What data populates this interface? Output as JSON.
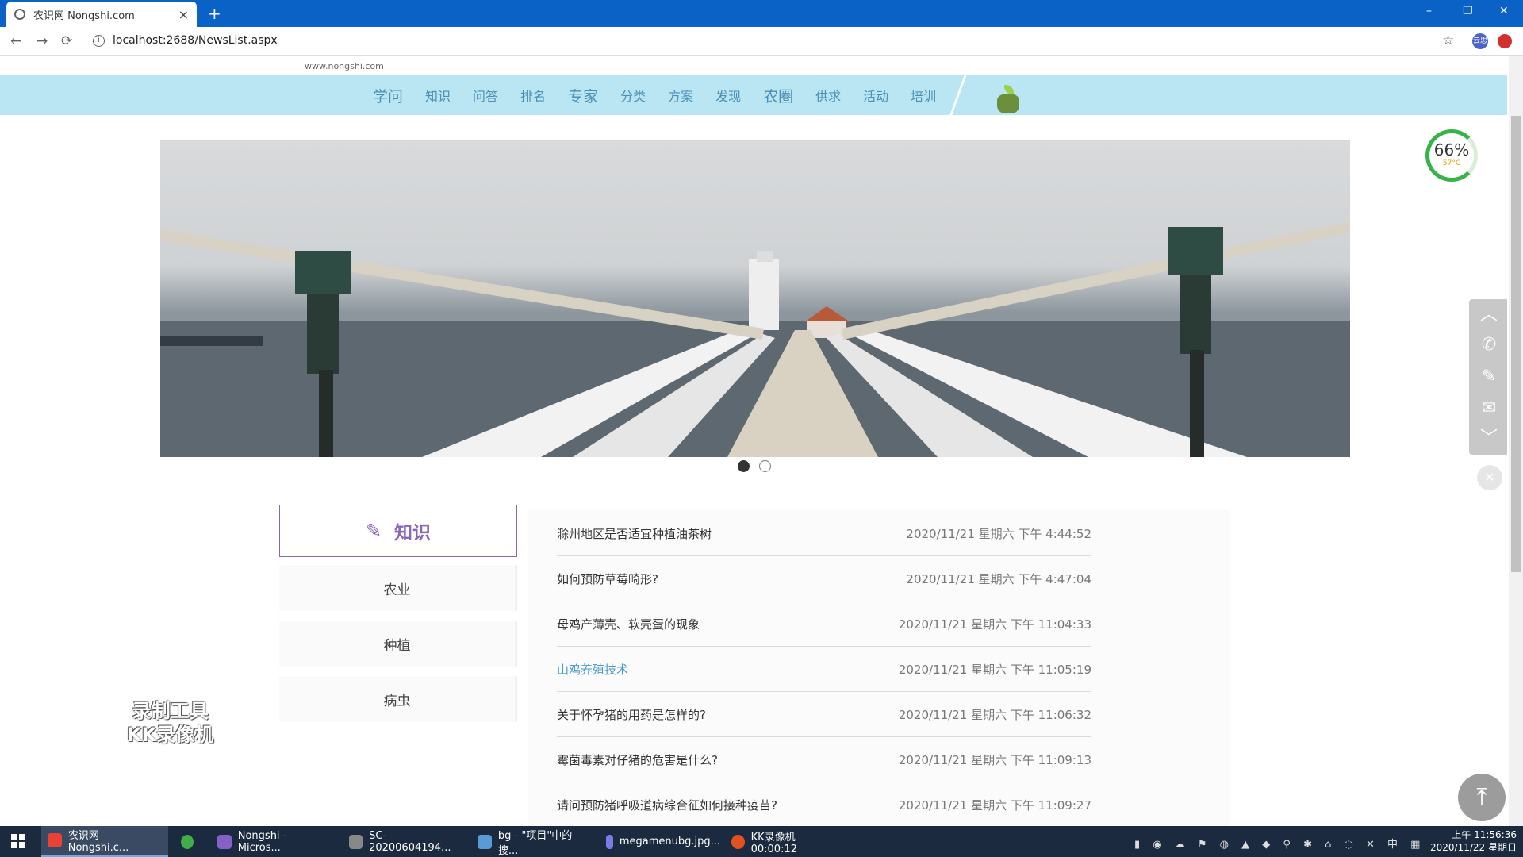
{
  "browser": {
    "tab_title": "农识网 Nongshi.com",
    "tab_close": "×",
    "new_tab": "+",
    "url": "localhost:2688/NewsList.aspx",
    "window_controls": [
      "–",
      "❐",
      "✕"
    ],
    "nav_buttons": [
      "←",
      "→",
      "⟳"
    ],
    "extension_label": "云思"
  },
  "site": {
    "logo_domain": "www.nongshi.com",
    "logo_title": "农识网",
    "nav": [
      "学问",
      "知识",
      "问答",
      "排名",
      "专家",
      "分类",
      "方案",
      "发现",
      "农圈",
      "供求",
      "活动",
      "培训"
    ],
    "carousel_count": 2,
    "carousel_active": 0
  },
  "sidebar": {
    "header_title": "知识",
    "items": [
      "农业",
      "种植",
      "病虫"
    ]
  },
  "news": [
    {
      "title": "滁州地区是否适宜种植油茶树",
      "date": "2020/11/21 星期六 下午 4:44:52",
      "link": false
    },
    {
      "title": "如何预防草莓畸形?",
      "date": "2020/11/21 星期六 下午 4:47:04",
      "link": false
    },
    {
      "title": "母鸡产薄壳、软壳蛋的现象",
      "date": "2020/11/21 星期六 下午 11:04:33",
      "link": false
    },
    {
      "title": "山鸡养殖技术",
      "date": "2020/11/21 星期六 下午 11:05:19",
      "link": true
    },
    {
      "title": "关于怀孕猪的用药是怎样的?",
      "date": "2020/11/21 星期六 下午 11:06:32",
      "link": false
    },
    {
      "title": "霉菌毒素对仔猪的危害是什么?",
      "date": "2020/11/21 星期六 下午 11:09:13",
      "link": false
    },
    {
      "title": "请问预防猪呼吸道病综合征如何接种疫苗?",
      "date": "2020/11/21 星期六 下午 11:09:27",
      "link": false
    }
  ],
  "watermark": [
    "录制工具",
    "KK录像机"
  ],
  "widgets": {
    "gauge_percent": "66%",
    "gauge_temp": "57°C"
  },
  "taskbar": {
    "tasks": [
      {
        "label": "农识网 Nongshi.c...",
        "color": "#e94235",
        "active": true
      },
      {
        "label": "",
        "color": "#3fae49",
        "active": false
      },
      {
        "label": "Nongshi - Micros...",
        "color": "#8661c5",
        "active": false
      },
      {
        "label": "SC-20200604194...",
        "color": "#888888",
        "active": false
      },
      {
        "label": "bg - \"项目\"中的搜...",
        "color": "#5b9bd5",
        "active": false
      },
      {
        "label": "megamenubg.jpg...",
        "color": "#7b7be8",
        "active": false
      },
      {
        "label": "KK录像机 00:00:12",
        "color": "#e0521f",
        "active": false
      }
    ],
    "tray_text": "中",
    "time": "上午 11:56:36",
    "date": "2020/11/22 星期日"
  },
  "colors": {
    "accent_purple": "#8a66b8",
    "nav_band": "#b9e6f2",
    "link_blue": "#4a9bd0",
    "gauge_green": "#37b34a"
  }
}
